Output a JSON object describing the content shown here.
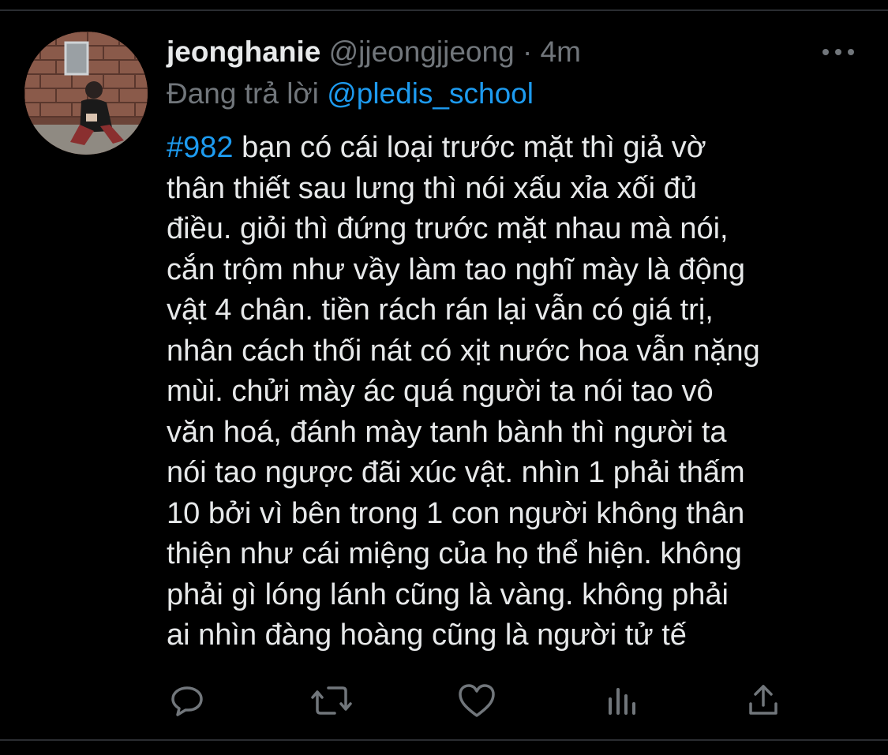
{
  "tweet": {
    "display_name": "jeonghanie",
    "handle": "@jjeongjjeong",
    "separator": "·",
    "time": "4m",
    "replying_prefix": "Đang trả lời",
    "replying_to": "@pledis_school",
    "hashtag": "#982",
    "lines": [
      " bạn có cái loại trước mặt thì giả vờ",
      "thân thiết sau lưng thì nói xấu xỉa xối đủ",
      "điều. giỏi thì đứng trước mặt nhau mà nói,",
      "cắn trộm như vầy làm tao nghĩ mày là động",
      "vật 4 chân. tiền rách rán lại vẫn có giá trị,",
      "nhân cách thối nát có xịt nước hoa vẫn nặng",
      "mùi. chửi mày ác quá người ta nói tao vô",
      "văn hoá, đánh mày tanh bành thì người ta",
      "nói tao ngược đãi xúc vật. nhìn 1 phải thấm",
      "10 bởi vì bên trong 1 con người không thân",
      "thiện như cái miệng của họ thể hiện. không",
      "phải gì lóng lánh cũng là vàng. không phải",
      "ai nhìn đàng hoàng cũng là người tử tế"
    ]
  },
  "icons": {
    "more": "more-horizontal-icon",
    "reply": "reply-icon",
    "retweet": "retweet-icon",
    "like": "heart-icon",
    "analytics": "analytics-icon",
    "share": "share-icon"
  },
  "colors": {
    "background": "#000000",
    "text": "#e7e9ea",
    "secondary": "#71767b",
    "accent": "#1d9bf0"
  }
}
